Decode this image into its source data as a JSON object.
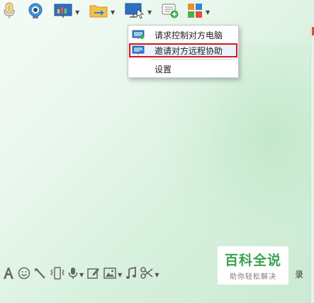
{
  "menu": {
    "items": [
      {
        "label": "请求控制对方电脑"
      },
      {
        "label": "邀请对方远程协助"
      },
      {
        "label": "设置"
      }
    ]
  },
  "watermark": {
    "title": "百科全说",
    "subtitle": "助你轻松解决"
  },
  "bottom_toolbar": {
    "trailing_text": "录"
  },
  "colors": {
    "highlight_border": "#d2171b",
    "accent_green": "#3aa24f",
    "background": "#e6f5ea"
  }
}
